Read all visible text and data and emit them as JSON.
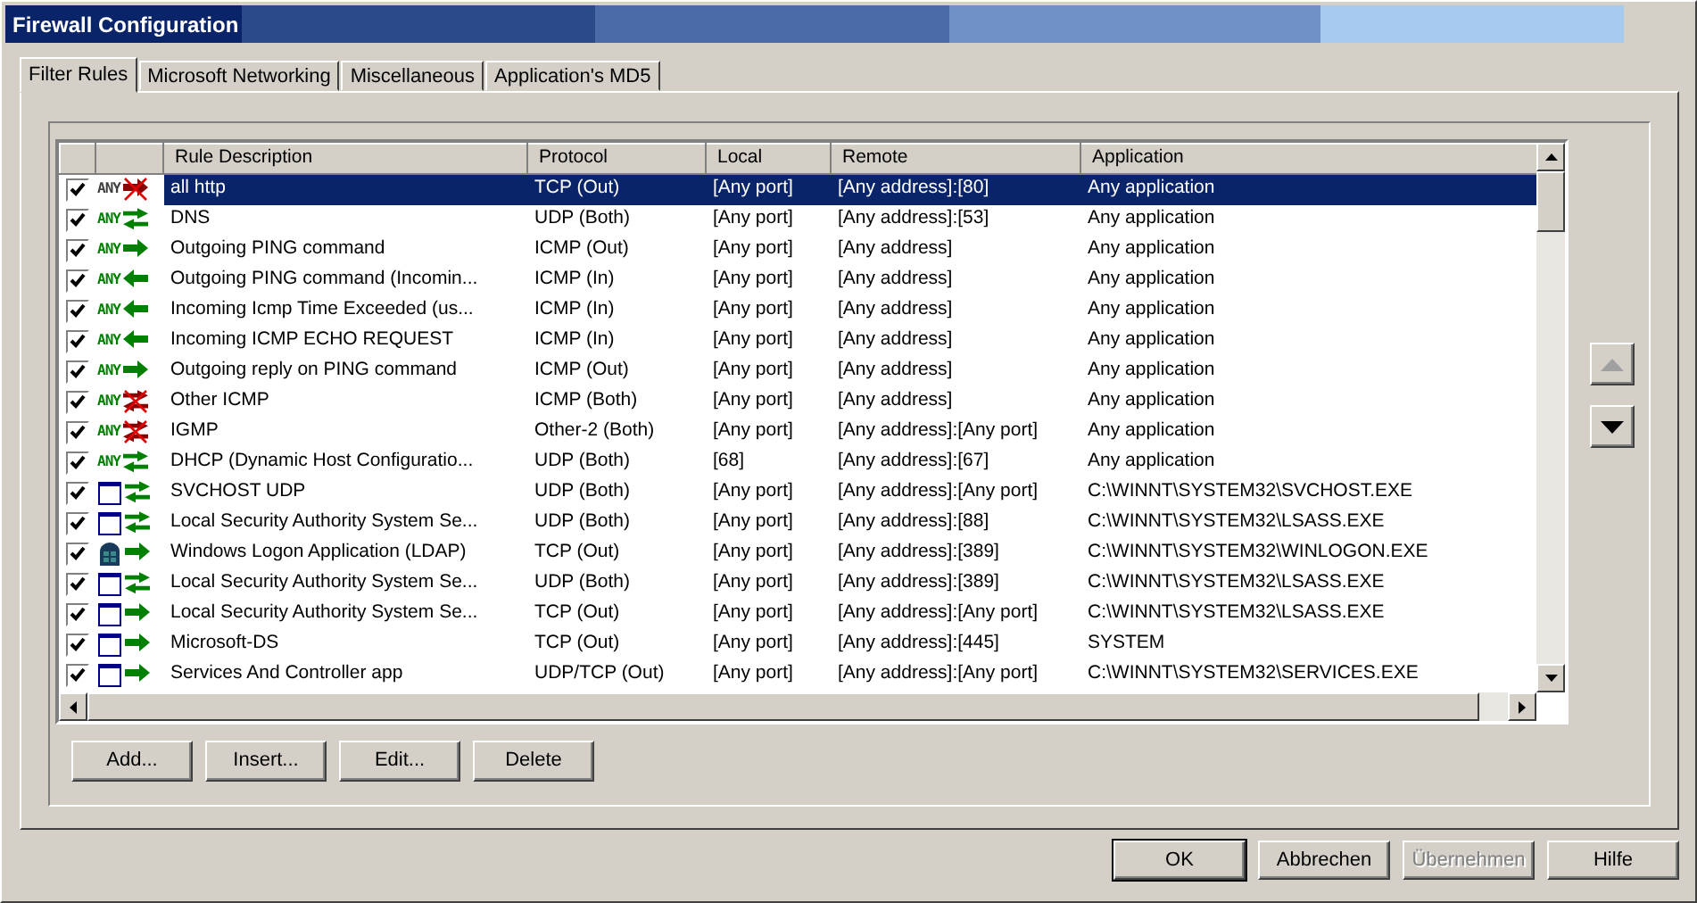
{
  "window": {
    "title": "Firewall Configuration"
  },
  "tabs": [
    {
      "label": "Filter Rules",
      "selected": true
    },
    {
      "label": "Microsoft Networking",
      "selected": false
    },
    {
      "label": "Miscellaneous",
      "selected": false
    },
    {
      "label": "Application's MD5",
      "selected": false
    }
  ],
  "table": {
    "columns": [
      "Rule Description",
      "Protocol",
      "Local",
      "Remote",
      "Application"
    ],
    "rows": [
      {
        "checked": true,
        "selected": true,
        "kind": "any",
        "scope": "ANY",
        "arrow": {
          "kind": "out",
          "blocked": true
        },
        "cells": [
          "all http",
          "TCP (Out)",
          "[Any port]",
          "[Any address]:[80]",
          "Any application"
        ]
      },
      {
        "checked": true,
        "selected": false,
        "kind": "any",
        "scope": "ANY",
        "arrow": {
          "kind": "both",
          "blocked": false
        },
        "cells": [
          "DNS",
          "UDP (Both)",
          "[Any port]",
          "[Any address]:[53]",
          "Any application"
        ]
      },
      {
        "checked": true,
        "selected": false,
        "kind": "any",
        "scope": "ANY",
        "arrow": {
          "kind": "out",
          "blocked": false
        },
        "cells": [
          "Outgoing PING command",
          "ICMP (Out)",
          "[Any port]",
          "[Any address]",
          "Any application"
        ]
      },
      {
        "checked": true,
        "selected": false,
        "kind": "any",
        "scope": "ANY",
        "arrow": {
          "kind": "in",
          "blocked": false
        },
        "cells": [
          "Outgoing PING command (Incomin...",
          "ICMP (In)",
          "[Any port]",
          "[Any address]",
          "Any application"
        ]
      },
      {
        "checked": true,
        "selected": false,
        "kind": "any",
        "scope": "ANY",
        "arrow": {
          "kind": "in",
          "blocked": false
        },
        "cells": [
          "Incoming Icmp Time Exceeded (us...",
          "ICMP (In)",
          "[Any port]",
          "[Any address]",
          "Any application"
        ]
      },
      {
        "checked": true,
        "selected": false,
        "kind": "any",
        "scope": "ANY",
        "arrow": {
          "kind": "in",
          "blocked": false
        },
        "cells": [
          "Incoming ICMP ECHO REQUEST",
          "ICMP (In)",
          "[Any port]",
          "[Any address]",
          "Any application"
        ]
      },
      {
        "checked": true,
        "selected": false,
        "kind": "any",
        "scope": "ANY",
        "arrow": {
          "kind": "out",
          "blocked": false
        },
        "cells": [
          "Outgoing reply on PING command",
          "ICMP (Out)",
          "[Any port]",
          "[Any address]",
          "Any application"
        ]
      },
      {
        "checked": true,
        "selected": false,
        "kind": "any",
        "scope": "ANY",
        "arrow": {
          "kind": "both",
          "blocked": true
        },
        "cells": [
          "Other ICMP",
          "ICMP (Both)",
          "[Any port]",
          "[Any address]",
          "Any application"
        ]
      },
      {
        "checked": true,
        "selected": false,
        "kind": "any",
        "scope": "ANY",
        "arrow": {
          "kind": "both",
          "blocked": true
        },
        "cells": [
          "IGMP",
          "Other-2 (Both)",
          "[Any port]",
          "[Any address]:[Any port]",
          "Any application"
        ]
      },
      {
        "checked": true,
        "selected": false,
        "kind": "any",
        "scope": "ANY",
        "arrow": {
          "kind": "both",
          "blocked": false
        },
        "cells": [
          "DHCP (Dynamic Host Configuratio...",
          "UDP (Both)",
          "[68]",
          "[Any address]:[67]",
          "Any application"
        ]
      },
      {
        "checked": true,
        "selected": false,
        "kind": "app",
        "arrow": {
          "kind": "both",
          "blocked": false
        },
        "cells": [
          "SVCHOST UDP",
          "UDP (Both)",
          "[Any port]",
          "[Any address]:[Any port]",
          "C:\\WINNT\\SYSTEM32\\SVCHOST.EXE"
        ]
      },
      {
        "checked": true,
        "selected": false,
        "kind": "app",
        "arrow": {
          "kind": "both",
          "blocked": false
        },
        "cells": [
          "Local Security Authority System Se...",
          "UDP (Both)",
          "[Any port]",
          "[Any address]:[88]",
          "C:\\WINNT\\SYSTEM32\\LSASS.EXE"
        ]
      },
      {
        "checked": true,
        "selected": false,
        "kind": "logon",
        "arrow": {
          "kind": "out",
          "blocked": false
        },
        "cells": [
          "Windows Logon Application (LDAP)",
          "TCP (Out)",
          "[Any port]",
          "[Any address]:[389]",
          "C:\\WINNT\\SYSTEM32\\WINLOGON.EXE"
        ]
      },
      {
        "checked": true,
        "selected": false,
        "kind": "app",
        "arrow": {
          "kind": "both",
          "blocked": false
        },
        "cells": [
          "Local Security Authority System Se...",
          "UDP (Both)",
          "[Any port]",
          "[Any address]:[389]",
          "C:\\WINNT\\SYSTEM32\\LSASS.EXE"
        ]
      },
      {
        "checked": true,
        "selected": false,
        "kind": "app",
        "arrow": {
          "kind": "out",
          "blocked": false
        },
        "cells": [
          "Local Security Authority System Se...",
          "TCP (Out)",
          "[Any port]",
          "[Any address]:[Any port]",
          "C:\\WINNT\\SYSTEM32\\LSASS.EXE"
        ]
      },
      {
        "checked": true,
        "selected": false,
        "kind": "app",
        "arrow": {
          "kind": "out",
          "blocked": false
        },
        "cells": [
          "Microsoft-DS",
          "TCP (Out)",
          "[Any port]",
          "[Any address]:[445]",
          "SYSTEM"
        ]
      },
      {
        "checked": true,
        "selected": false,
        "kind": "app",
        "arrow": {
          "kind": "out",
          "blocked": false
        },
        "cells": [
          "Services And Controller app",
          "UDP/TCP (Out)",
          "[Any port]",
          "[Any address]:[Any port]",
          "C:\\WINNT\\SYSTEM32\\SERVICES.EXE"
        ]
      }
    ]
  },
  "list_buttons": [
    {
      "label": "Add...",
      "disabled": false
    },
    {
      "label": "Insert...",
      "disabled": false
    },
    {
      "label": "Edit...",
      "disabled": false
    },
    {
      "label": "Delete",
      "disabled": false
    }
  ],
  "dialog_buttons": [
    {
      "label": "OK",
      "disabled": false,
      "default": true
    },
    {
      "label": "Abbrechen",
      "disabled": false,
      "default": false
    },
    {
      "label": "Übernehmen",
      "disabled": true,
      "default": false
    },
    {
      "label": "Hilfe",
      "disabled": false,
      "default": false
    }
  ]
}
